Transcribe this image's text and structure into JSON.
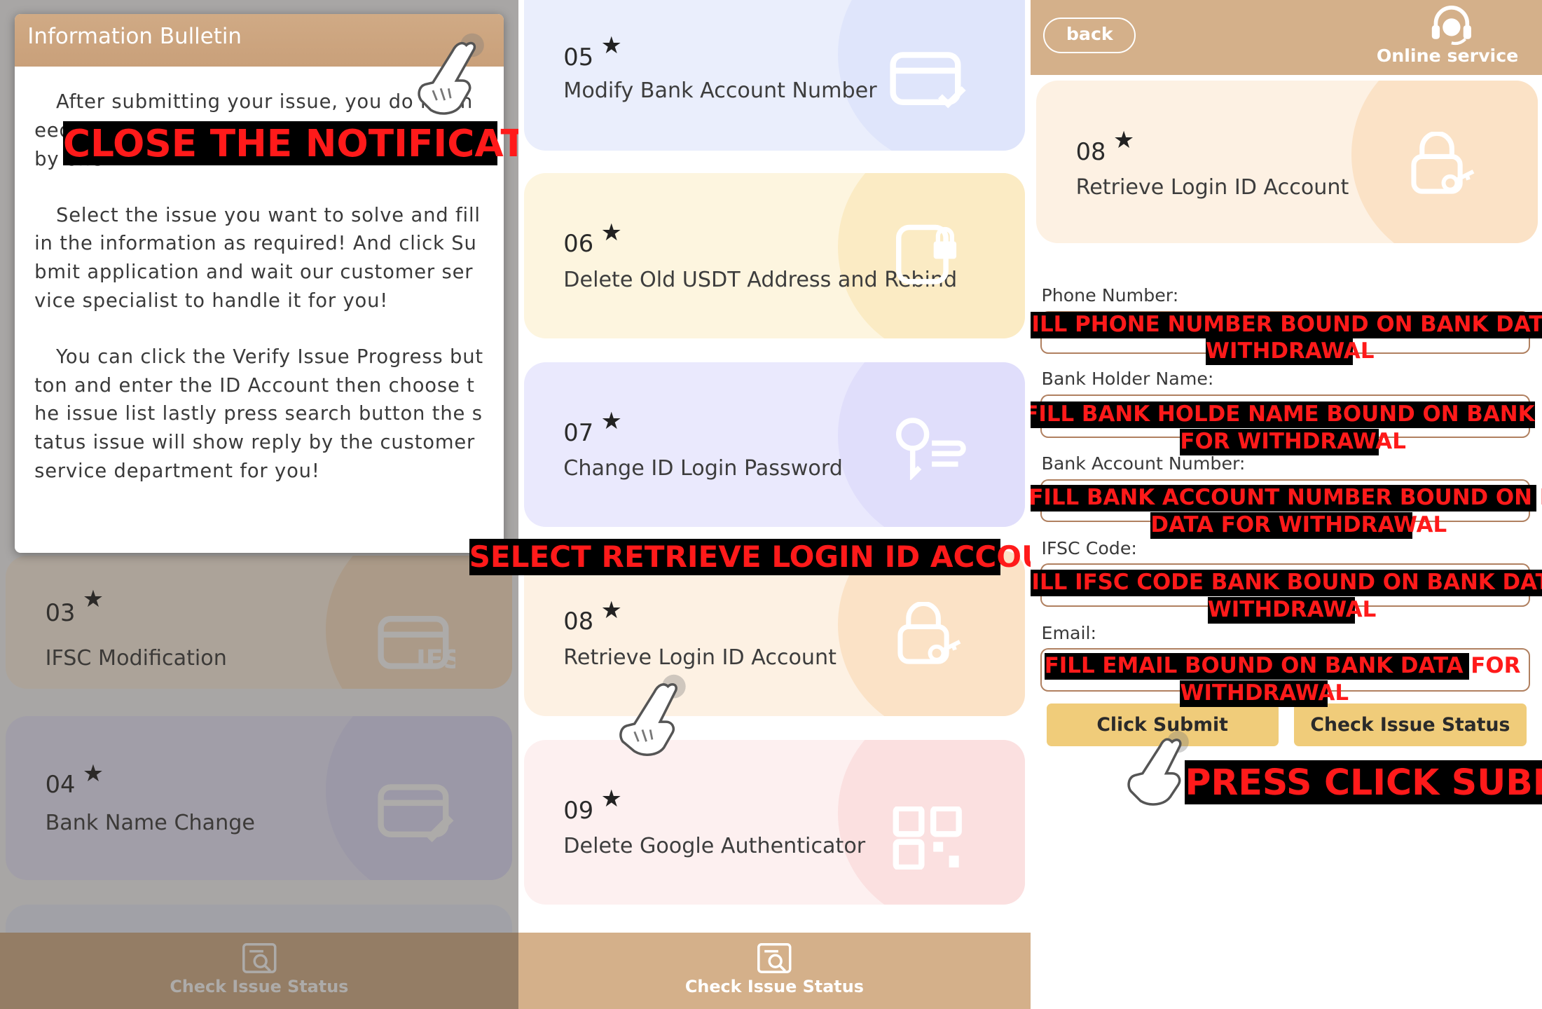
{
  "panel1": {
    "cards": [
      {
        "num": "03",
        "label": "IFSC Modification",
        "icon": "ifs-card-icon"
      },
      {
        "num": "04",
        "label": "Bank Name Change",
        "icon": "card-edit-icon"
      }
    ],
    "bottom_bar": {
      "label": "Check Issue Status",
      "icon": "search-document-icon"
    },
    "modal": {
      "title": "Information Bulletin",
      "paragraphs": [
        "After submitting your issue, you do not need to wait, our specialist will handle it one by one.",
        "Select the issue you want to solve and fill in the information as required! And click Submit application and wait our customer service specialist to handle it for you!",
        "You can click the Verify Issue Progress button and enter the ID Account then choose the issue list lastly press search button the status issue will show reply by the customer service department for you!"
      ]
    },
    "annotation": "CLOSE THE NOTIFICATION"
  },
  "panel2": {
    "cards": [
      {
        "num": "05",
        "label": "Modify Bank Account Number",
        "icon": "card-check-icon"
      },
      {
        "num": "06",
        "label": "Delete Old USDT Address and Rebind",
        "icon": "lock-box-icon"
      },
      {
        "num": "07",
        "label": "Change ID Login Password",
        "icon": "key-lines-icon"
      },
      {
        "num": "08",
        "label": "Retrieve Login ID Account",
        "icon": "lock-key-icon"
      },
      {
        "num": "09",
        "label": "Delete Google Authenticator",
        "icon": "qr-code-icon"
      }
    ],
    "bottom_bar": {
      "label": "Check Issue Status",
      "icon": "search-document-icon"
    },
    "annotation": "SELECT RETRIEVE LOGIN ID ACCOUNT"
  },
  "panel3": {
    "back_label": "back",
    "online_service_label": "Online service",
    "card": {
      "num": "08",
      "label": "Retrieve Login ID Account",
      "icon": "lock-key-icon"
    },
    "fields": [
      {
        "label": "Phone Number:",
        "annotation": [
          "FILL PHONE NUMBER BOUND ON BANK DATA FOR",
          "WITHDRAWAL"
        ]
      },
      {
        "label": "Bank Holder Name:",
        "annotation": [
          "FILL BANK HOLDE NAME BOUND ON BANK DATA",
          "FOR WITHDRAWAL"
        ]
      },
      {
        "label": "Bank Account Number:",
        "annotation": [
          "FILL BANK ACCOUNT NUMBER BOUND ON BANK",
          "DATA FOR WITHDRAWAL"
        ]
      },
      {
        "label": "IFSC Code:",
        "annotation": [
          "FILL IFSC CODE BANK BOUND ON BANK DATA FOR",
          "WITHDRAWAL"
        ]
      },
      {
        "label": "Email:",
        "annotation": [
          "FILL EMAIL BOUND ON BANK DATA FOR",
          "WITHDRAWAL"
        ]
      }
    ],
    "submit_label": "Click Submit",
    "check_label": "Check Issue Status",
    "annotation": "PRESS CLICK SUBMIT"
  },
  "colors": {
    "brand_tan": "#d4b08a",
    "button_yellow": "#f0cc7a",
    "annotation_red": "#ff1a1a"
  }
}
